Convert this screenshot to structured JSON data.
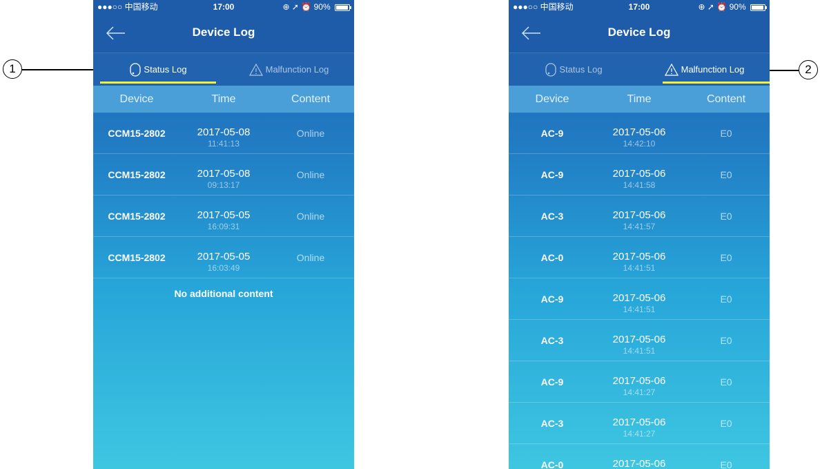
{
  "callouts": [
    "1",
    "2"
  ],
  "screens": [
    {
      "status_bar": {
        "carrier": "●●●○○ 中国移动",
        "time": "17:00",
        "battery": "90%"
      },
      "title": "Device Log",
      "tabs": [
        {
          "label": "Status Log",
          "icon": "status-log-icon",
          "active": true
        },
        {
          "label": "Malfunction Log",
          "icon": "warning-triangle-icon",
          "active": false
        }
      ],
      "columns": [
        "Device",
        "Time",
        "Content"
      ],
      "rows": [
        {
          "device": "CCM15-2802",
          "date": "2017-05-08",
          "time": "11:41:13",
          "content": "Online"
        },
        {
          "device": "CCM15-2802",
          "date": "2017-05-08",
          "time": "09:13:17",
          "content": "Online"
        },
        {
          "device": "CCM15-2802",
          "date": "2017-05-05",
          "time": "16:09:31",
          "content": "Online"
        },
        {
          "device": "CCM15-2802",
          "date": "2017-05-05",
          "time": "16:03:49",
          "content": "Online"
        }
      ],
      "footer": "No additional content"
    },
    {
      "status_bar": {
        "carrier": "●●●○○ 中国移动",
        "time": "17:00",
        "battery": "90%"
      },
      "title": "Device Log",
      "tabs": [
        {
          "label": "Status Log",
          "icon": "status-log-icon",
          "active": false
        },
        {
          "label": "Malfunction Log",
          "icon": "warning-triangle-icon",
          "active": true
        }
      ],
      "columns": [
        "Device",
        "Time",
        "Content"
      ],
      "rows": [
        {
          "device": "AC-9",
          "date": "2017-05-06",
          "time": "14:42:10",
          "content": "E0"
        },
        {
          "device": "AC-9",
          "date": "2017-05-06",
          "time": "14:41:58",
          "content": "E0"
        },
        {
          "device": "AC-3",
          "date": "2017-05-06",
          "time": "14:41:57",
          "content": "E0"
        },
        {
          "device": "AC-0",
          "date": "2017-05-06",
          "time": "14:41:51",
          "content": "E0"
        },
        {
          "device": "AC-9",
          "date": "2017-05-06",
          "time": "14:41:51",
          "content": "E0"
        },
        {
          "device": "AC-3",
          "date": "2017-05-06",
          "time": "14:41:51",
          "content": "E0"
        },
        {
          "device": "AC-9",
          "date": "2017-05-06",
          "time": "14:41:27",
          "content": "E0"
        },
        {
          "device": "AC-3",
          "date": "2017-05-06",
          "time": "14:41:27",
          "content": "E0"
        },
        {
          "device": "AC-0",
          "date": "2017-05-06",
          "time": "",
          "content": "E0"
        }
      ],
      "footer": ""
    }
  ]
}
